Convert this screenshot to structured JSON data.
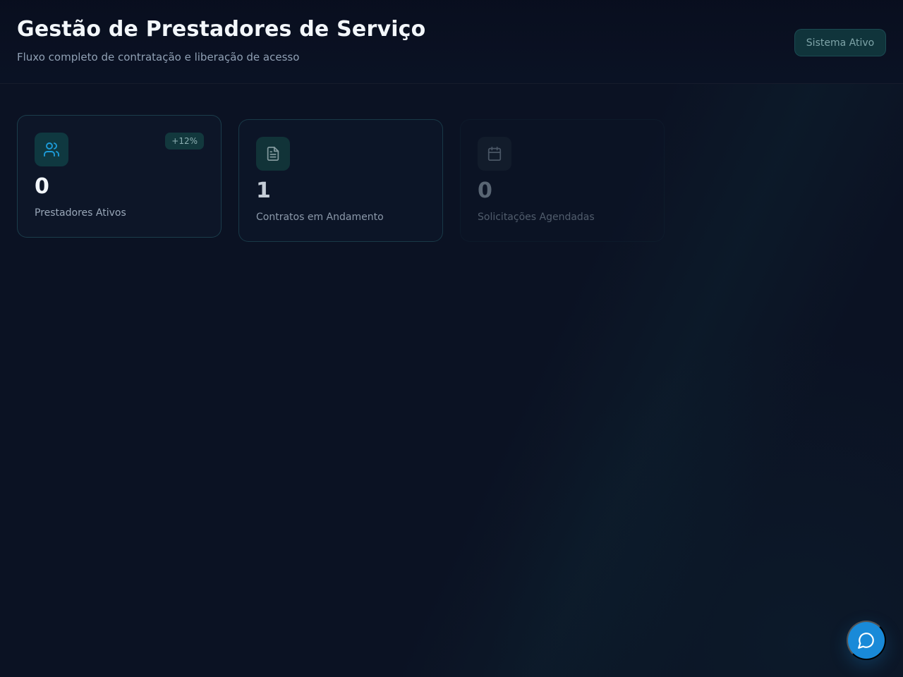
{
  "header": {
    "title": "Gestão de Prestadores de Serviço",
    "subtitle": "Fluxo completo de contratação e liberação de acesso",
    "status": "Sistema Ativo"
  },
  "cards": [
    {
      "icon": "users-icon",
      "badge": "+12%",
      "value": "0",
      "label": "Prestadores Ativos"
    },
    {
      "icon": "document-icon",
      "value": "1",
      "label": "Contratos em Andamento"
    },
    {
      "icon": "calendar-icon",
      "value": "0",
      "label": "Solicitações Agendadas"
    }
  ],
  "fab": {
    "icon": "chat-icon"
  },
  "colors": {
    "background": "#0b1223",
    "accent": "#198ad8",
    "teal": "#10343b",
    "text_primary": "#f3f7fb",
    "text_secondary": "#90a0b4"
  }
}
